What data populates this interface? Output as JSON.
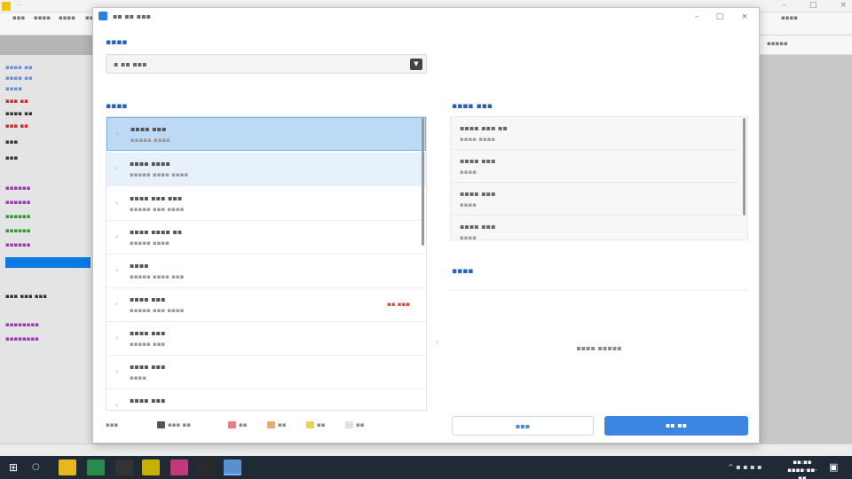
{
  "background_app": {
    "title": "···",
    "toolbar_items": [
      "▪▪▪",
      "▪▪▪▪",
      "▪▪▪▪",
      "▪▪▪",
      "▪▪▪▪"
    ],
    "right_strip": "▪▪▪▪▪",
    "left_lines": [
      {
        "text": "▪▪▪▪ ▪▪",
        "color": "#6a8fd6"
      },
      {
        "text": "▪▪▪▪ ▪▪",
        "color": "#6a8fd6"
      },
      {
        "text": "▪▪▪▪",
        "color": "#6a8fd6"
      },
      {
        "text": "▪▪▪ ▪▪",
        "color": "#d02a2a"
      },
      {
        "text": "▪▪▪▪ ▪▪",
        "color": "#333333"
      },
      {
        "text": "▪▪▪ ▪▪",
        "color": "#d02a2a"
      },
      {
        "text": "▪▪▪",
        "color": "#333333"
      },
      {
        "text": "▪▪▪",
        "color": "#333333"
      },
      {
        "text": "▪▪▪▪▪▪",
        "color": "#9a3ab0"
      },
      {
        "text": "▪▪▪▪▪▪",
        "color": "#9a3ab0"
      },
      {
        "text": "▪▪▪▪▪▪",
        "color": "#2e9a2e"
      },
      {
        "text": "▪▪▪▪▪▪",
        "color": "#2e9a2e"
      },
      {
        "text": "▪▪▪▪▪▪",
        "color": "#9a3ab0"
      },
      {
        "text": "▪▪▪ ▪▪▪ ▪▪▪",
        "color": "#333333"
      },
      {
        "text": "▪▪▪▪▪▪▪▪",
        "color": "#9a3ab0"
      },
      {
        "text": "▪▪▪▪▪▪▪▪",
        "color": "#9a3ab0"
      }
    ]
  },
  "dialog": {
    "title": "▪▪ ▪▪ ▪▪▪",
    "controls": [
      "–",
      "□",
      "×"
    ],
    "section_select": "▪▪▪▪",
    "select_value": "▪ ▪▪ ▪▪▪",
    "section_source": "▪▪▪▪",
    "section_selected": "▪▪▪▪ ▪▪▪",
    "section_preview": "▪▪▪▪",
    "source_items": [
      {
        "name": "▪▪▪▪ ▪▪▪",
        "sub": "▪▪▪▪▪ ▪▪▪▪",
        "warn": "",
        "state": "selected"
      },
      {
        "name": "▪▪▪▪ ▪▪▪▪",
        "sub": "▪▪▪▪▪ ▪▪▪▪ ▪▪▪▪",
        "warn": "",
        "state": "hover"
      },
      {
        "name": "▪▪▪▪ ▪▪▪ ▪▪▪",
        "sub": "▪▪▪▪▪ ▪▪▪ ▪▪▪▪",
        "warn": "",
        "state": ""
      },
      {
        "name": "▪▪▪▪ ▪▪▪▪ ▪▪",
        "sub": "▪▪▪▪▪ ▪▪▪▪",
        "warn": "",
        "state": ""
      },
      {
        "name": "▪▪▪▪",
        "sub": "▪▪▪▪▪ ▪▪▪▪ ▪▪▪",
        "warn": "",
        "state": ""
      },
      {
        "name": "▪▪▪▪ ▪▪▪",
        "sub": "▪▪▪▪▪ ▪▪▪ ▪▪▪▪",
        "warn": "▪▪ ▪▪▪",
        "state": ""
      },
      {
        "name": "▪▪▪▪ ▪▪▪",
        "sub": "▪▪▪▪▪ ▪▪▪",
        "warn": "",
        "state": ""
      },
      {
        "name": "▪▪▪▪ ▪▪▪",
        "sub": "▪▪▪▪",
        "warn": "",
        "state": ""
      },
      {
        "name": "▪▪▪▪ ▪▪▪",
        "sub": "",
        "warn": "",
        "state": ""
      }
    ],
    "selected_items": [
      {
        "name": "▪▪▪▪ ▪▪▪ ▪▪",
        "sub": "▪▪▪▪ ▪▪▪▪"
      },
      {
        "name": "▪▪▪▪ ▪▪▪",
        "sub": "▪▪▪▪"
      },
      {
        "name": "▪▪▪▪ ▪▪▪",
        "sub": "▪▪▪▪"
      },
      {
        "name": "▪▪▪▪ ▪▪▪",
        "sub": "▪▪▪▪"
      }
    ],
    "preview_empty": "▪▪▪▪ ▪▪▪▪▪",
    "legend": [
      {
        "label": "▪▪▪",
        "color": ""
      },
      {
        "label": "▪▪▪ ▪▪",
        "color": "#555555"
      },
      {
        "label": "▪▪",
        "color": "#f07a7a"
      },
      {
        "label": "▪▪",
        "color": "#f0a860"
      },
      {
        "label": "▪▪",
        "color": "#f0d050"
      },
      {
        "label": "▪▪",
        "color": "#e0e0e0"
      }
    ],
    "buttons": {
      "secondary": "▪▪▪",
      "primary": "▪▪ ▪▪"
    }
  },
  "taskbar": {
    "tray": "^ ▪ ▪ ▪ ▪",
    "clock_time": "▪▪:▪▪",
    "clock_date": "▪▪▪▪-▪▪-▪▪",
    "apps": [
      {
        "name": "folder",
        "color": "#e8b820"
      },
      {
        "name": "app-green",
        "color": "#2a8a4a"
      },
      {
        "name": "app-dark",
        "color": "#333333"
      },
      {
        "name": "app-yellow",
        "color": "#c8b000"
      },
      {
        "name": "app-pink",
        "color": "#c03a7a"
      },
      {
        "name": "app-terminal",
        "color": "#2a2a2a"
      },
      {
        "name": "app-blue",
        "color": "#5a90d0"
      }
    ]
  }
}
